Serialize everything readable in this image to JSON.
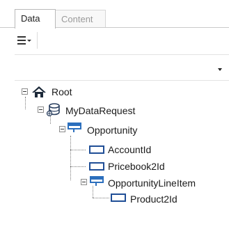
{
  "tabs": [
    {
      "label": "Data",
      "active": true
    },
    {
      "label": "Content",
      "active": false
    }
  ],
  "toolbar": {
    "menu_icon": "hamburger-menu-icon"
  },
  "dropdown": {
    "value": ""
  },
  "tree": {
    "nodes": [
      {
        "label": "Root",
        "icon": "home-icon",
        "expanded": true
      },
      {
        "label": "MyDataRequest",
        "icon": "data-request-icon",
        "expanded": true
      },
      {
        "label": "Opportunity",
        "icon": "object-icon",
        "expanded": true
      },
      {
        "label": "AccountId",
        "icon": "field-icon"
      },
      {
        "label": "Pricebook2Id",
        "icon": "field-icon"
      },
      {
        "label": "OpportunityLineItem",
        "icon": "object-icon",
        "expanded": true
      },
      {
        "label": "Product2Id",
        "icon": "field-icon"
      }
    ]
  },
  "colors": {
    "accent_blue": "#1f4e96",
    "object_blue": "#2c6fbd",
    "tree_line": "#7a7a7a"
  }
}
